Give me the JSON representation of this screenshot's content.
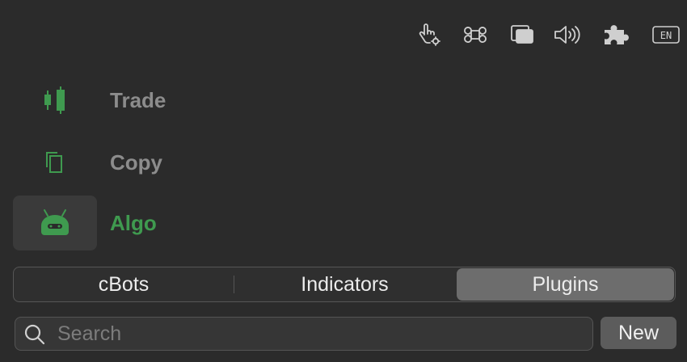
{
  "toolbar": {
    "icons": [
      "hand-pointer-settings-icon",
      "command-icon",
      "windows-icon",
      "speaker-icon",
      "puzzle-icon",
      "language-icon"
    ],
    "language_code": "EN"
  },
  "nav": {
    "items": [
      {
        "label": "Trade",
        "icon": "candlestick-icon",
        "active": false
      },
      {
        "label": "Copy",
        "icon": "copy-icon",
        "active": false
      },
      {
        "label": "Algo",
        "icon": "robot-icon",
        "active": true
      }
    ]
  },
  "tabs": {
    "items": [
      {
        "label": "cBots",
        "selected": false
      },
      {
        "label": "Indicators",
        "selected": false
      },
      {
        "label": "Plugins",
        "selected": true
      }
    ]
  },
  "search": {
    "placeholder": "Search",
    "value": ""
  },
  "actions": {
    "new_label": "New"
  },
  "colors": {
    "accent": "#3f9a4f",
    "background": "#2b2b2b",
    "inactive_text": "#8c8c8c"
  }
}
